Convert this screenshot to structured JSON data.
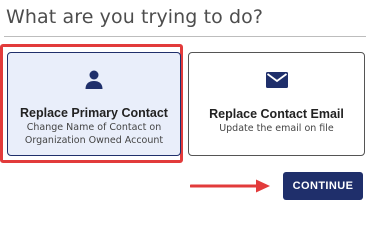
{
  "heading": "What are you trying to do?",
  "options": [
    {
      "title": "Replace Primary Contact",
      "description": "Change Name of Contact on Organization Owned Account",
      "icon": "person-icon",
      "selected": true
    },
    {
      "title": "Replace Contact Email",
      "description": "Update the email on file",
      "icon": "envelope-icon",
      "selected": false
    }
  ],
  "continue_label": "CONTINUE",
  "colors": {
    "primary": "#1f2f6b",
    "selected_bg": "#e9eefa",
    "annotation_red": "#e23b3b",
    "heading_text": "#4d4d4d"
  }
}
